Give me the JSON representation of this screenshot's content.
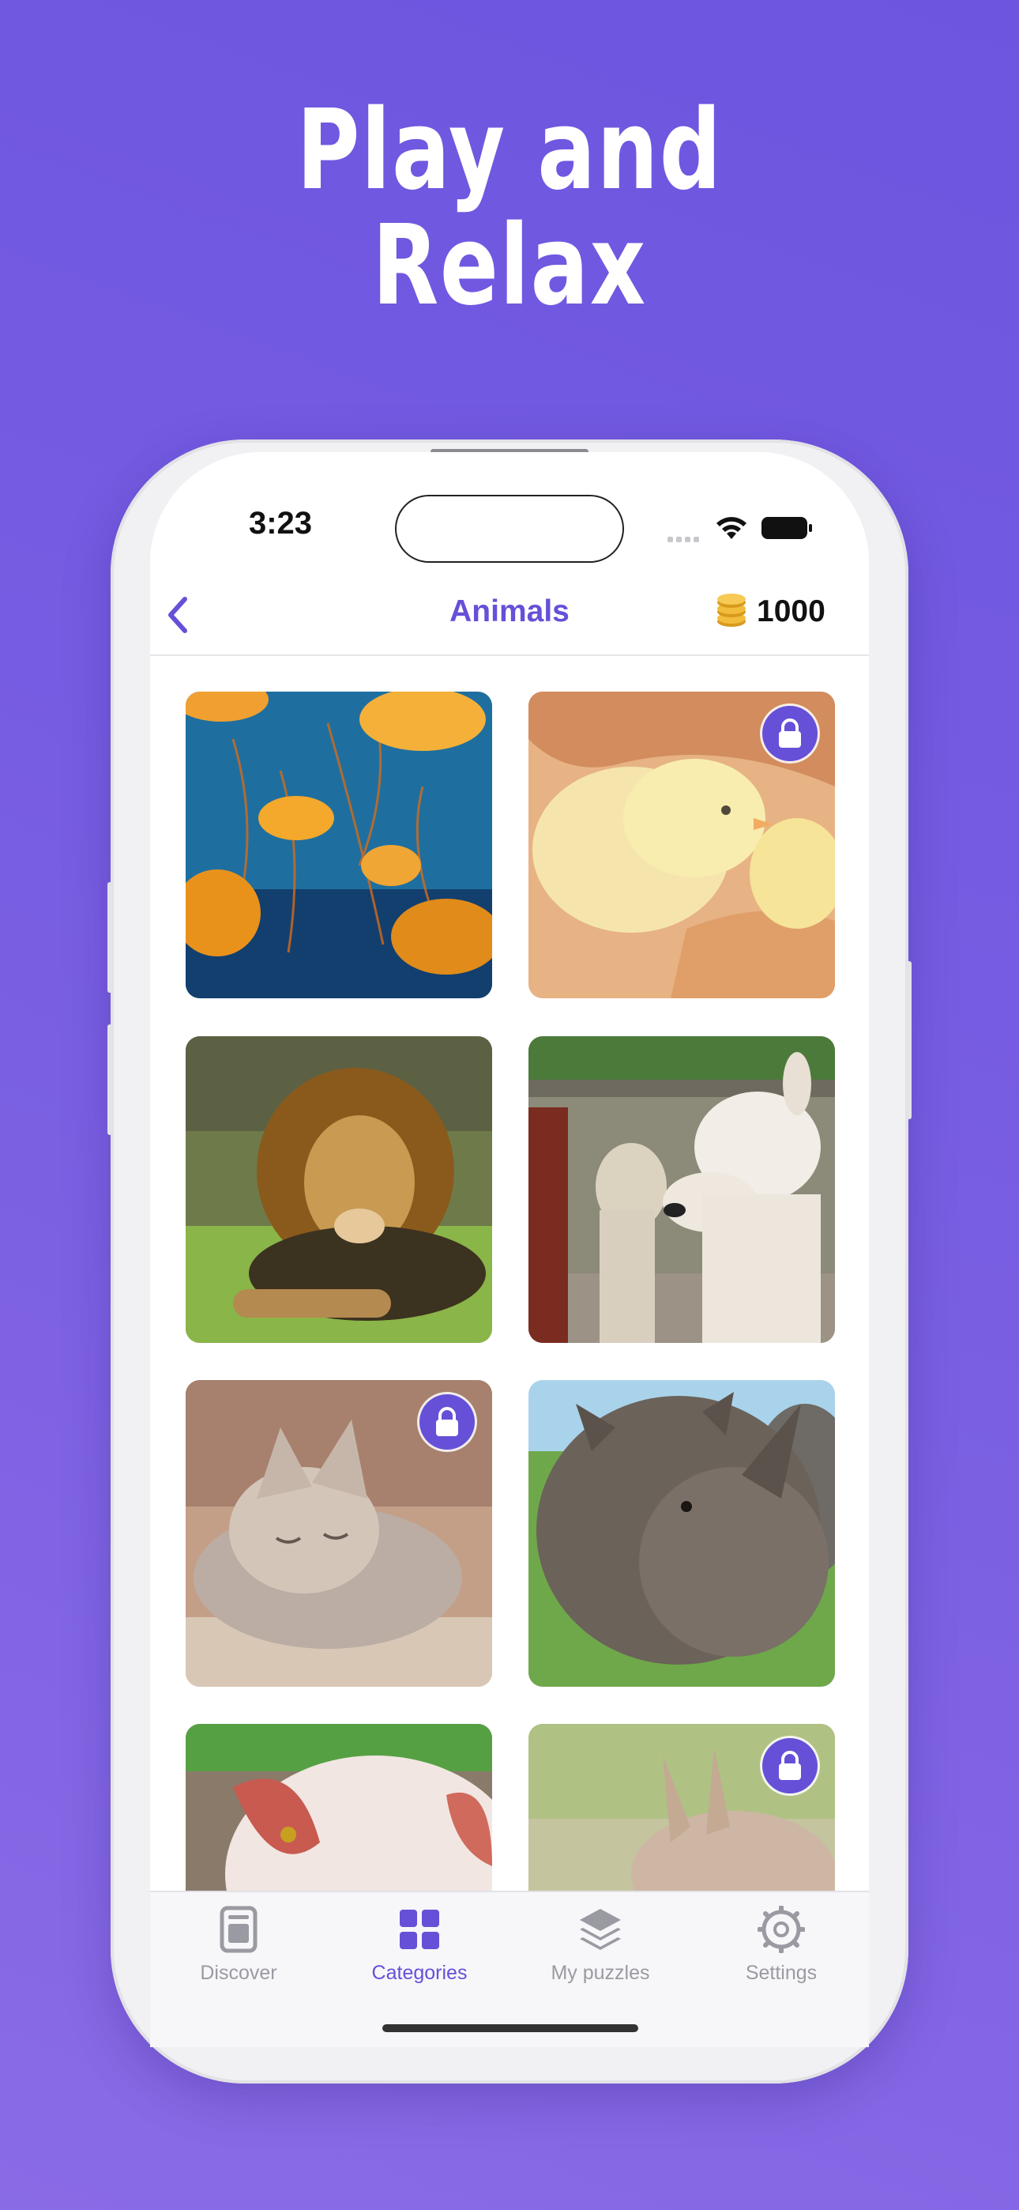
{
  "headline": {
    "line1": "Play and",
    "line2": "Relax"
  },
  "status_bar": {
    "time": "3:23"
  },
  "nav": {
    "title": "Animals",
    "coins": "1000"
  },
  "grid": {
    "items": [
      {
        "name": "jellyfish",
        "locked": false
      },
      {
        "name": "chicks",
        "locked": true
      },
      {
        "name": "lion",
        "locked": false
      },
      {
        "name": "alpacas",
        "locked": false
      },
      {
        "name": "kitten",
        "locked": true
      },
      {
        "name": "rhino",
        "locked": false
      },
      {
        "name": "pig",
        "locked": false
      },
      {
        "name": "kangaroo",
        "locked": true
      }
    ]
  },
  "tabs": [
    {
      "label": "Discover",
      "icon": "document-icon",
      "active": false
    },
    {
      "label": "Categories",
      "icon": "grid-icon",
      "active": true
    },
    {
      "label": "My puzzles",
      "icon": "layers-icon",
      "active": false
    },
    {
      "label": "Settings",
      "icon": "gear-icon",
      "active": false
    }
  ],
  "colors": {
    "accent": "#6650d8",
    "background": "#7058e0",
    "inactive": "#9a9aa2"
  }
}
